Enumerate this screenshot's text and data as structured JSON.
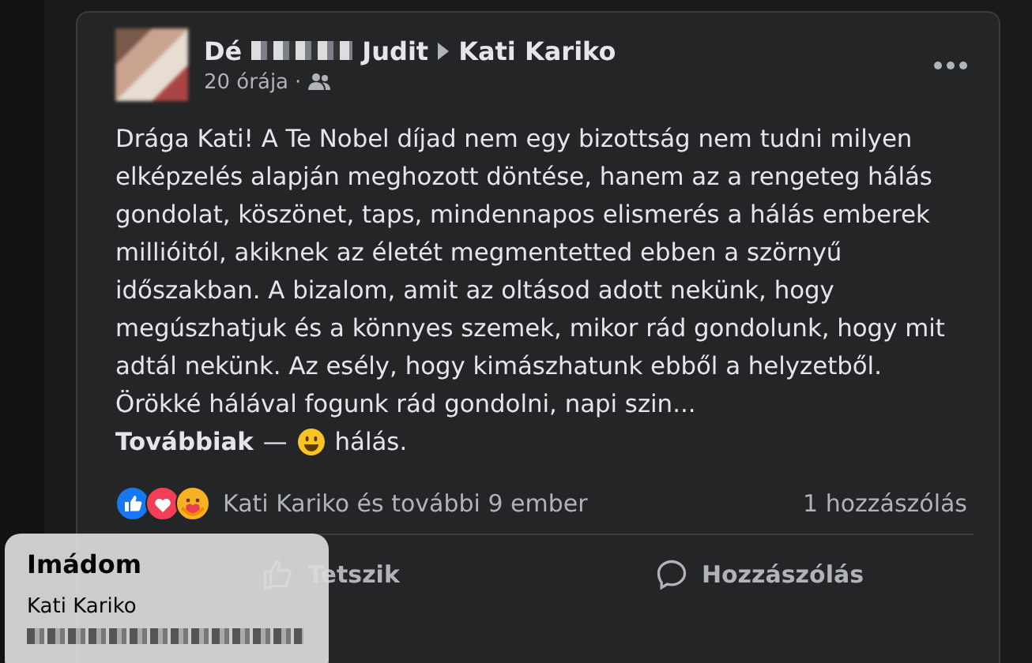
{
  "post": {
    "author_first": "Dé",
    "author_last": "Judit",
    "target": "Kati Kariko",
    "time": "20 órája",
    "separator": "·",
    "body": "Drága Kati! A Te Nobel díjad nem egy bizottság nem tudni milyen elképzelés alapján meghozott döntése, hanem az a rengeteg hálás gondolat, köszönet, taps, mindennapos elismerés a hálás emberek millióitól, akiknek az életét megmentetted ebben a szörnyű időszakban. A bizalom, amit az oltásod adott nekünk, hogy megúszhatjuk és a könnyes szemek, mikor rád gondolunk, hogy mit adtál nekünk. Az esély, hogy kimászhatunk ebből a helyzetből. Örökké hálával fogunk rád gondolni, napi szin...",
    "see_more": "Továbbiak",
    "dash": "—",
    "feeling": "hálás.",
    "reactions_text": "Kati Kariko és további 9 ember",
    "comments_count": "1 hozzászólás",
    "actions": [
      {
        "kind": "like",
        "label": "Tetszik"
      },
      {
        "kind": "comment",
        "label": "Hozzászólás"
      }
    ]
  },
  "tooltip": {
    "title": "Imádom",
    "names": [
      "Kati Kariko"
    ]
  }
}
